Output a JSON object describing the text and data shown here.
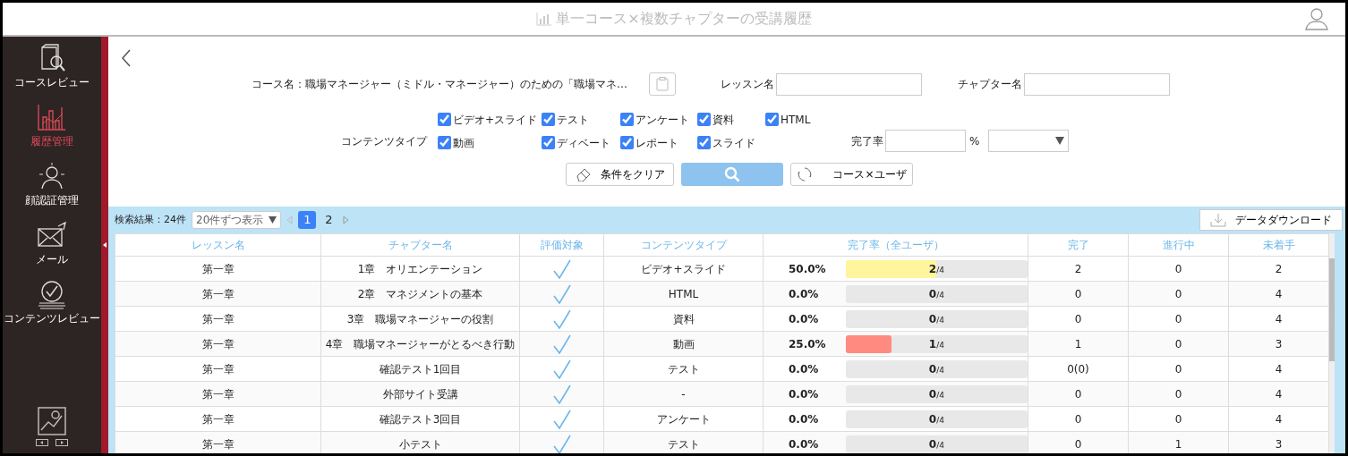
{
  "header": {
    "title": "単一コース×複数チャプターの受講履歴"
  },
  "sidebar": {
    "items": [
      {
        "label": "コースレビュー",
        "kind": "book",
        "selected": false
      },
      {
        "label": "履歴管理",
        "kind": "chart",
        "selected": true
      },
      {
        "label": "顔認証管理",
        "kind": "person",
        "selected": false
      },
      {
        "label": "メール",
        "kind": "mail",
        "selected": false
      },
      {
        "label": "コンテンツレビュー",
        "kind": "review",
        "selected": false
      }
    ]
  },
  "filters": {
    "course": "コース名：職場マネージャー（ミドル・マネージャー）のための「職場マネ…",
    "lesson_label": "レッスン名",
    "chapter_label": "チャプター名",
    "content_type_label": "コンテンツタイプ",
    "content_types": [
      {
        "label": "ビデオ+スライド",
        "checked": true
      },
      {
        "label": "テスト",
        "checked": true
      },
      {
        "label": "アンケート",
        "checked": true
      },
      {
        "label": "資料",
        "checked": true
      },
      {
        "label": "HTML",
        "checked": true
      },
      {
        "label": "動画",
        "checked": true
      },
      {
        "label": "ディベート",
        "checked": true
      },
      {
        "label": "レポート",
        "checked": true
      },
      {
        "label": "スライド",
        "checked": true
      }
    ],
    "completion_label": "完了率",
    "completion_unit": "%",
    "clear_button": "条件をクリア",
    "switch_button": "コース×ユーザ"
  },
  "results": {
    "count": "検索結果：24件",
    "per_page": "20件ずつ表示",
    "pages": [
      {
        "label": "1",
        "selected": true
      },
      {
        "label": "2",
        "selected": false
      }
    ],
    "download_button": "データダウンロード"
  },
  "table": {
    "columns": [
      "レッスン名",
      "チャプター名",
      "評価対象",
      "コンテンツタイプ",
      "完了率（全ユーザ）",
      "完了",
      "進行中",
      "未着手"
    ],
    "rows": [
      {
        "lesson": "第一章",
        "chapter": "1章　オリエンテーション",
        "evaluated": true,
        "type": "ビデオ+スライド",
        "rate": "50.0%",
        "level": 0.5,
        "color": "#fff59d",
        "progress": "2$_{/4}$",
        "done": "2",
        "in_progress": "0",
        "not_started": "2"
      },
      {
        "lesson": "第一章",
        "chapter": "2章　マネジメントの基本",
        "evaluated": true,
        "type": "HTML",
        "rate": "0.0%",
        "progress": "0$_{/4}$",
        "done": "0",
        "in_progress": "0",
        "not_started": "4"
      },
      {
        "lesson": "第一章",
        "chapter": "3章　職場マネージャーの役割",
        "evaluated": true,
        "type": "資料",
        "rate": "0.0%",
        "progress": "0$_{/4}$",
        "done": "0",
        "in_progress": "0",
        "not_started": "4"
      },
      {
        "lesson": "第一章",
        "chapter": "4章　職場マネージャーがとるべき行動",
        "evaluated": true,
        "type": "動画",
        "rate": "25.0%",
        "level": 0.25,
        "color": "#ff8a80",
        "progress": "1$_{/4}$",
        "done": "1",
        "in_progress": "0",
        "not_started": "3"
      },
      {
        "lesson": "第一章",
        "chapter": "確認テスト1回目",
        "evaluated": true,
        "type": "テスト",
        "rate": "0.0%",
        "progress": "0$_{/4}$",
        "done": "0(0)",
        "in_progress": "0",
        "not_started": "4"
      },
      {
        "lesson": "第一章",
        "chapter": "外部サイト受講",
        "evaluated": true,
        "type": "-",
        "rate": "0.0%",
        "progress": "0$_{/4}$",
        "done": "0",
        "in_progress": "0",
        "not_started": "4"
      },
      {
        "lesson": "第一章",
        "chapter": "確認テスト3回目",
        "evaluated": true,
        "type": "アンケート",
        "rate": "0.0%",
        "progress": "0$_{/4}$",
        "done": "0",
        "in_progress": "0",
        "not_started": "4"
      },
      {
        "lesson": "第一章",
        "chapter": "小テスト",
        "evaluated": true,
        "type": "テスト",
        "rate": "0.0%",
        "progress": "0$_{/4}$",
        "done": "0",
        "in_progress": "1",
        "not_started": "3"
      }
    ]
  }
}
